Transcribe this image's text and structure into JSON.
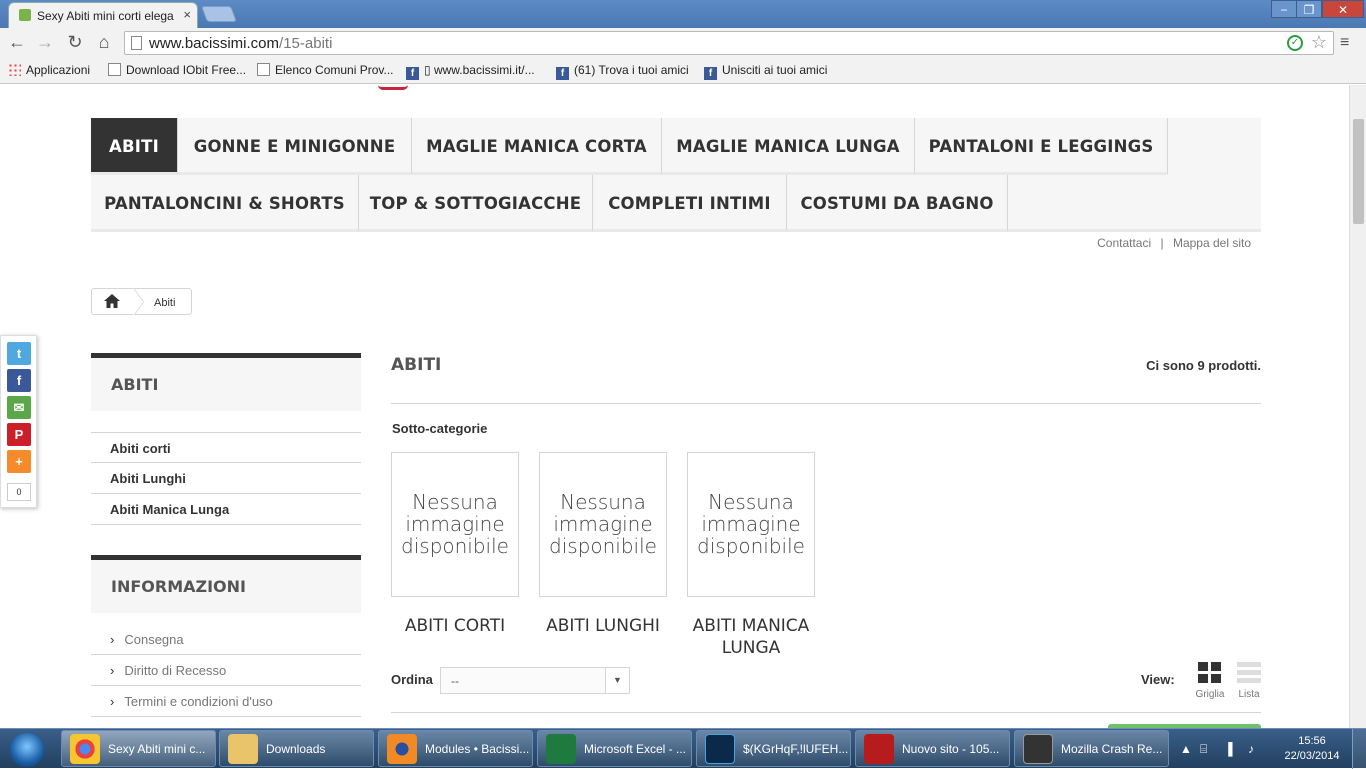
{
  "browser": {
    "tab_title": "Sexy Abiti mini corti elega",
    "tab_close": "×",
    "url_host": "www.bacissimi.com",
    "url_path": "/15-abiti",
    "bookmarks": [
      {
        "label": "Applicazioni",
        "icon": "apps-icon"
      },
      {
        "label": "Download IObit Free...",
        "icon": "page-icon"
      },
      {
        "label": "Elenco Comuni Prov...",
        "icon": "page-icon"
      },
      {
        "label": "▯ www.bacissimi.it/...",
        "icon": "facebook-icon"
      },
      {
        "label": "(61) Trova i tuoi amici",
        "icon": "facebook-icon"
      },
      {
        "label": "Unisciti ai tuoi amici",
        "icon": "facebook-icon"
      }
    ]
  },
  "menu": {
    "row1": [
      "ABITI",
      "GONNE E MINIGONNE",
      "MAGLIE MANICA CORTA",
      "MAGLIE MANICA LUNGA",
      "PANTALONI E LEGGINGS"
    ],
    "row2": [
      "PANTALONCINI & SHORTS",
      "TOP & SOTTOGIACCHE",
      "COMPLETI INTIMI",
      "COSTUMI DA BAGNO"
    ]
  },
  "toplinks": {
    "contact": "Contattaci",
    "sep": "|",
    "sitemap": "Mappa del sito"
  },
  "breadcrumb": {
    "current": "Abiti"
  },
  "sidebar": {
    "categories_title": "ABITI",
    "categories": [
      "Abiti corti",
      "Abiti Lunghi",
      "Abiti Manica Lunga"
    ],
    "info_title": "INFORMAZIONI",
    "info": [
      "Consegna",
      "Diritto di Recesso",
      "Termini e condizioni d'uso"
    ],
    "chevron": "›"
  },
  "share": {
    "count": "0"
  },
  "main": {
    "heading": "ABITI",
    "product_count": "Ci sono 9 prodotti.",
    "subcategories_label": "Sotto-categorie",
    "no_image_text": "Nessuna immagine disponibile",
    "subcategories": [
      "ABITI CORTI",
      "ABITI LUNGHI",
      "ABITI MANICA LUNGA"
    ],
    "sort_label": "Ordina",
    "sort_value": "--",
    "view_label": "View:",
    "grid_label": "Griglia",
    "list_label": "Lista"
  },
  "taskbar": {
    "tasks": [
      "Sexy Abiti mini c...",
      "Downloads",
      "Modules • Bacissi...",
      "Microsoft Excel - ...",
      "$(KGrHqF,!lUFEH...",
      "Nuovo sito - 105...",
      "Mozilla Crash Re..."
    ],
    "time": "15:56",
    "date": "22/03/2014"
  },
  "colors": {
    "accent_dark": "#333333",
    "brand_red": "#c9253c",
    "button_green": "#6fc16b"
  }
}
